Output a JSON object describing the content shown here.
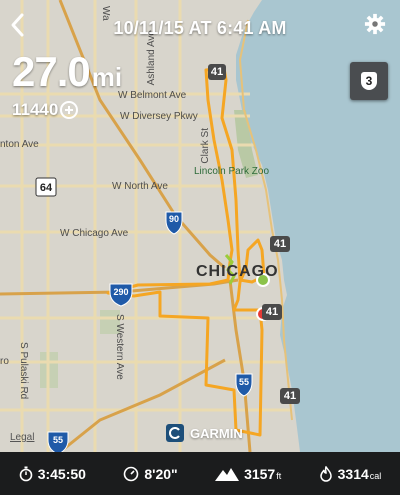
{
  "header": {
    "date": "10/11/15 AT 6:41 AM",
    "distance_value": "27.0",
    "distance_unit": "mi",
    "elevation_gain": "11440"
  },
  "badge": {
    "level": "3"
  },
  "map": {
    "streets": [
      {
        "text": "W Belmont Ave"
      },
      {
        "text": "W Diversey Pkwy"
      },
      {
        "text": "W North Ave"
      },
      {
        "text": "W Chicago Ave"
      },
      {
        "text": "nton Ave"
      },
      {
        "text": "Ashland Ave"
      },
      {
        "text": "Clark St"
      },
      {
        "text": "Lincoln Park Zoo"
      },
      {
        "text": "CHICAGO"
      },
      {
        "text": "S Western Ave"
      },
      {
        "text": "S Pulaski Rd"
      },
      {
        "text": "ro"
      },
      {
        "text": "Wa"
      }
    ],
    "shields": {
      "i290": "290",
      "i90": "90",
      "i55_center": "55",
      "i55_bottom": "55",
      "us41_top": "41",
      "us41_mid": "41",
      "us41_lower": "41",
      "us41_bottom": "41",
      "il64": "64"
    },
    "colors": {
      "water": "#a9c6d0",
      "land": "#d8d5cc",
      "route": "#f5a623",
      "start": "#8bc34a",
      "end": "#e53935"
    }
  },
  "attribution": {
    "brand": "GARMIN",
    "legal": "Legal"
  },
  "stats": {
    "duration": "3:45:50",
    "pace": "8'20\"",
    "elevation": "3157",
    "elevation_unit": "ft",
    "calories": "3314",
    "calories_unit": "cal"
  }
}
